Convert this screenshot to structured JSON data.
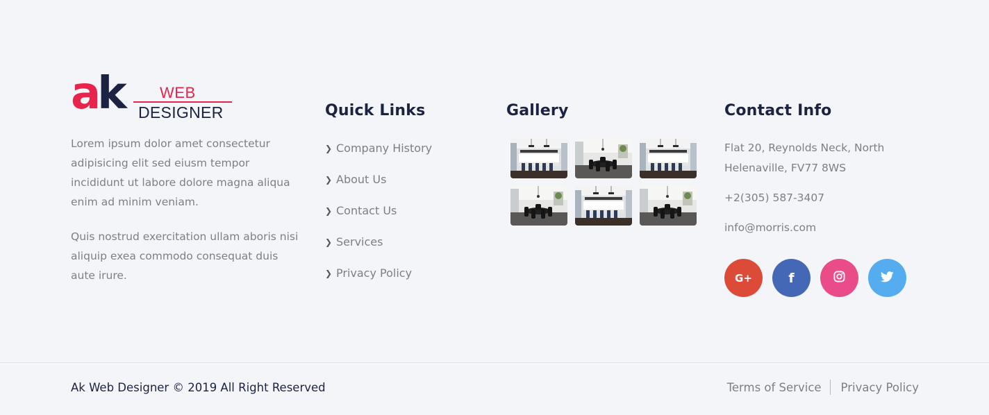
{
  "colors": {
    "background": "#f4f5f8",
    "heading": "#1c2242",
    "accent": "#e8244d",
    "text": "#7e7f86",
    "google_plus": "#dc4a38",
    "facebook": "#4468b6",
    "instagram": "#ea4c89",
    "twitter": "#55acee"
  },
  "logo": {
    "letter_a": "a",
    "letter_k": "k",
    "word_top": "WEB",
    "word_bottom": "DESIGNER"
  },
  "about": {
    "paragraph_1": "Lorem ipsum dolor amet consectetur adipisicing elit sed eiusm tempor incididunt ut labore dolore magna aliqua enim ad minim veniam.",
    "paragraph_2": "Quis nostrud exercitation ullam aboris nisi aliquip exea commodo consequat duis aute irure."
  },
  "quick_links": {
    "title": "Quick Links",
    "icon": "chevron-right-icon",
    "items": [
      {
        "label": "Company History"
      },
      {
        "label": "About Us"
      },
      {
        "label": "Contact Us"
      },
      {
        "label": "Services"
      },
      {
        "label": "Privacy Policy"
      }
    ]
  },
  "gallery": {
    "title": "Gallery",
    "images": [
      {
        "scene": "kitchen"
      },
      {
        "scene": "dining"
      },
      {
        "scene": "kitchen"
      },
      {
        "scene": "dining"
      },
      {
        "scene": "kitchen"
      },
      {
        "scene": "dining"
      }
    ]
  },
  "contact": {
    "title": "Contact Info",
    "address": "Flat 20, Reynolds Neck, North Helenaville, FV77 8WS",
    "phone": "+2(305) 587-3407",
    "email": "info@morris.com",
    "socials": [
      {
        "icon": "google-plus-icon",
        "glyph": "G+"
      },
      {
        "icon": "facebook-icon",
        "glyph": "f"
      },
      {
        "icon": "instagram-icon",
        "glyph": ""
      },
      {
        "icon": "twitter-icon",
        "glyph": ""
      }
    ]
  },
  "bottom": {
    "copyright": "Ak Web Designer © 2019 All Right Reserved",
    "terms": "Terms of Service",
    "privacy": "Privacy Policy"
  }
}
